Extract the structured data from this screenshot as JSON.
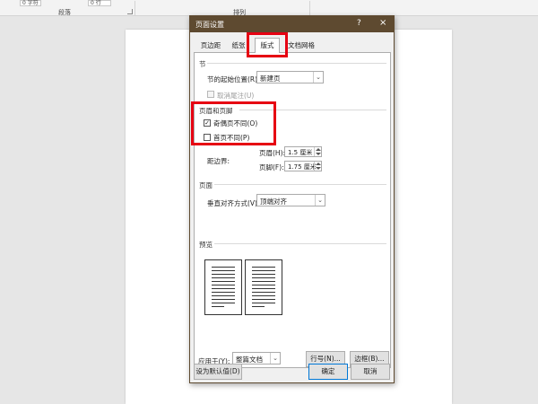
{
  "ribbon": {
    "spin_left": "0 字符",
    "spin_right": "0 行",
    "group_paragraph": "段落",
    "group_arrange": "排列"
  },
  "dialog": {
    "title": "页面设置",
    "help": "?",
    "close": "×",
    "tabs": [
      "页边距",
      "纸张",
      "版式",
      "文档网格"
    ],
    "active_tab": "版式",
    "section": {
      "title": "节",
      "start_label": "节的起始位置(R):",
      "start_value": "新建页",
      "suppress_endnotes_label": "取消尾注(U)",
      "suppress_endnotes_checked": false,
      "suppress_endnotes_enabled": false
    },
    "headers_footers": {
      "title": "页眉和页脚",
      "odd_even_label": "奇偶页不同(O)",
      "odd_even_checked": true,
      "first_page_label": "首页不同(P)",
      "first_page_checked": false,
      "from_edge_label": "距边界:",
      "header_label": "页眉(H):",
      "header_value": "1.5 厘米",
      "footer_label": "页脚(F):",
      "footer_value": "1.75 厘米"
    },
    "page": {
      "title": "页面",
      "valign_label": "垂直对齐方式(V):",
      "valign_value": "顶端对齐"
    },
    "preview": {
      "title": "预览"
    },
    "apply_to_label": "应用于(Y):",
    "apply_to_value": "整篇文档",
    "line_numbers_button": "行号(N)...",
    "borders_button": "边框(B)...",
    "set_default_button": "设为默认值(D)",
    "ok_button": "确定",
    "cancel_button": "取消"
  },
  "highlight_color": "#e60012",
  "titlebar_color": "#5e4a30"
}
